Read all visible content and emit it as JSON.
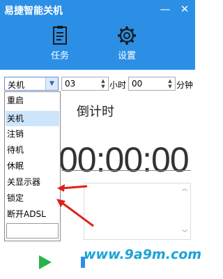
{
  "window": {
    "title": "易捷智能关机",
    "minimize": "—",
    "close": "✕"
  },
  "toolbar": {
    "task": {
      "label": "任务",
      "icon": "clipboard-icon"
    },
    "settings": {
      "label": "设置",
      "icon": "gear-icon"
    }
  },
  "controls": {
    "action_selected": "关机",
    "hour_value": "03",
    "hour_unit": "小时",
    "minute_value": "00",
    "minute_unit": "分钟"
  },
  "dropdown": {
    "options": [
      "重启",
      "关机",
      "注销",
      "待机",
      "休眠",
      "关显示器",
      "锁定",
      "断开ADSL"
    ],
    "selected_index": 1
  },
  "main": {
    "countdown_label": "倒计时",
    "timer": "00:00:00"
  },
  "watermark": "www.9a9m.com",
  "colors": {
    "accent": "#2b8fe6",
    "play": "#25b34a",
    "annotation_arrow": "#e0201a"
  }
}
